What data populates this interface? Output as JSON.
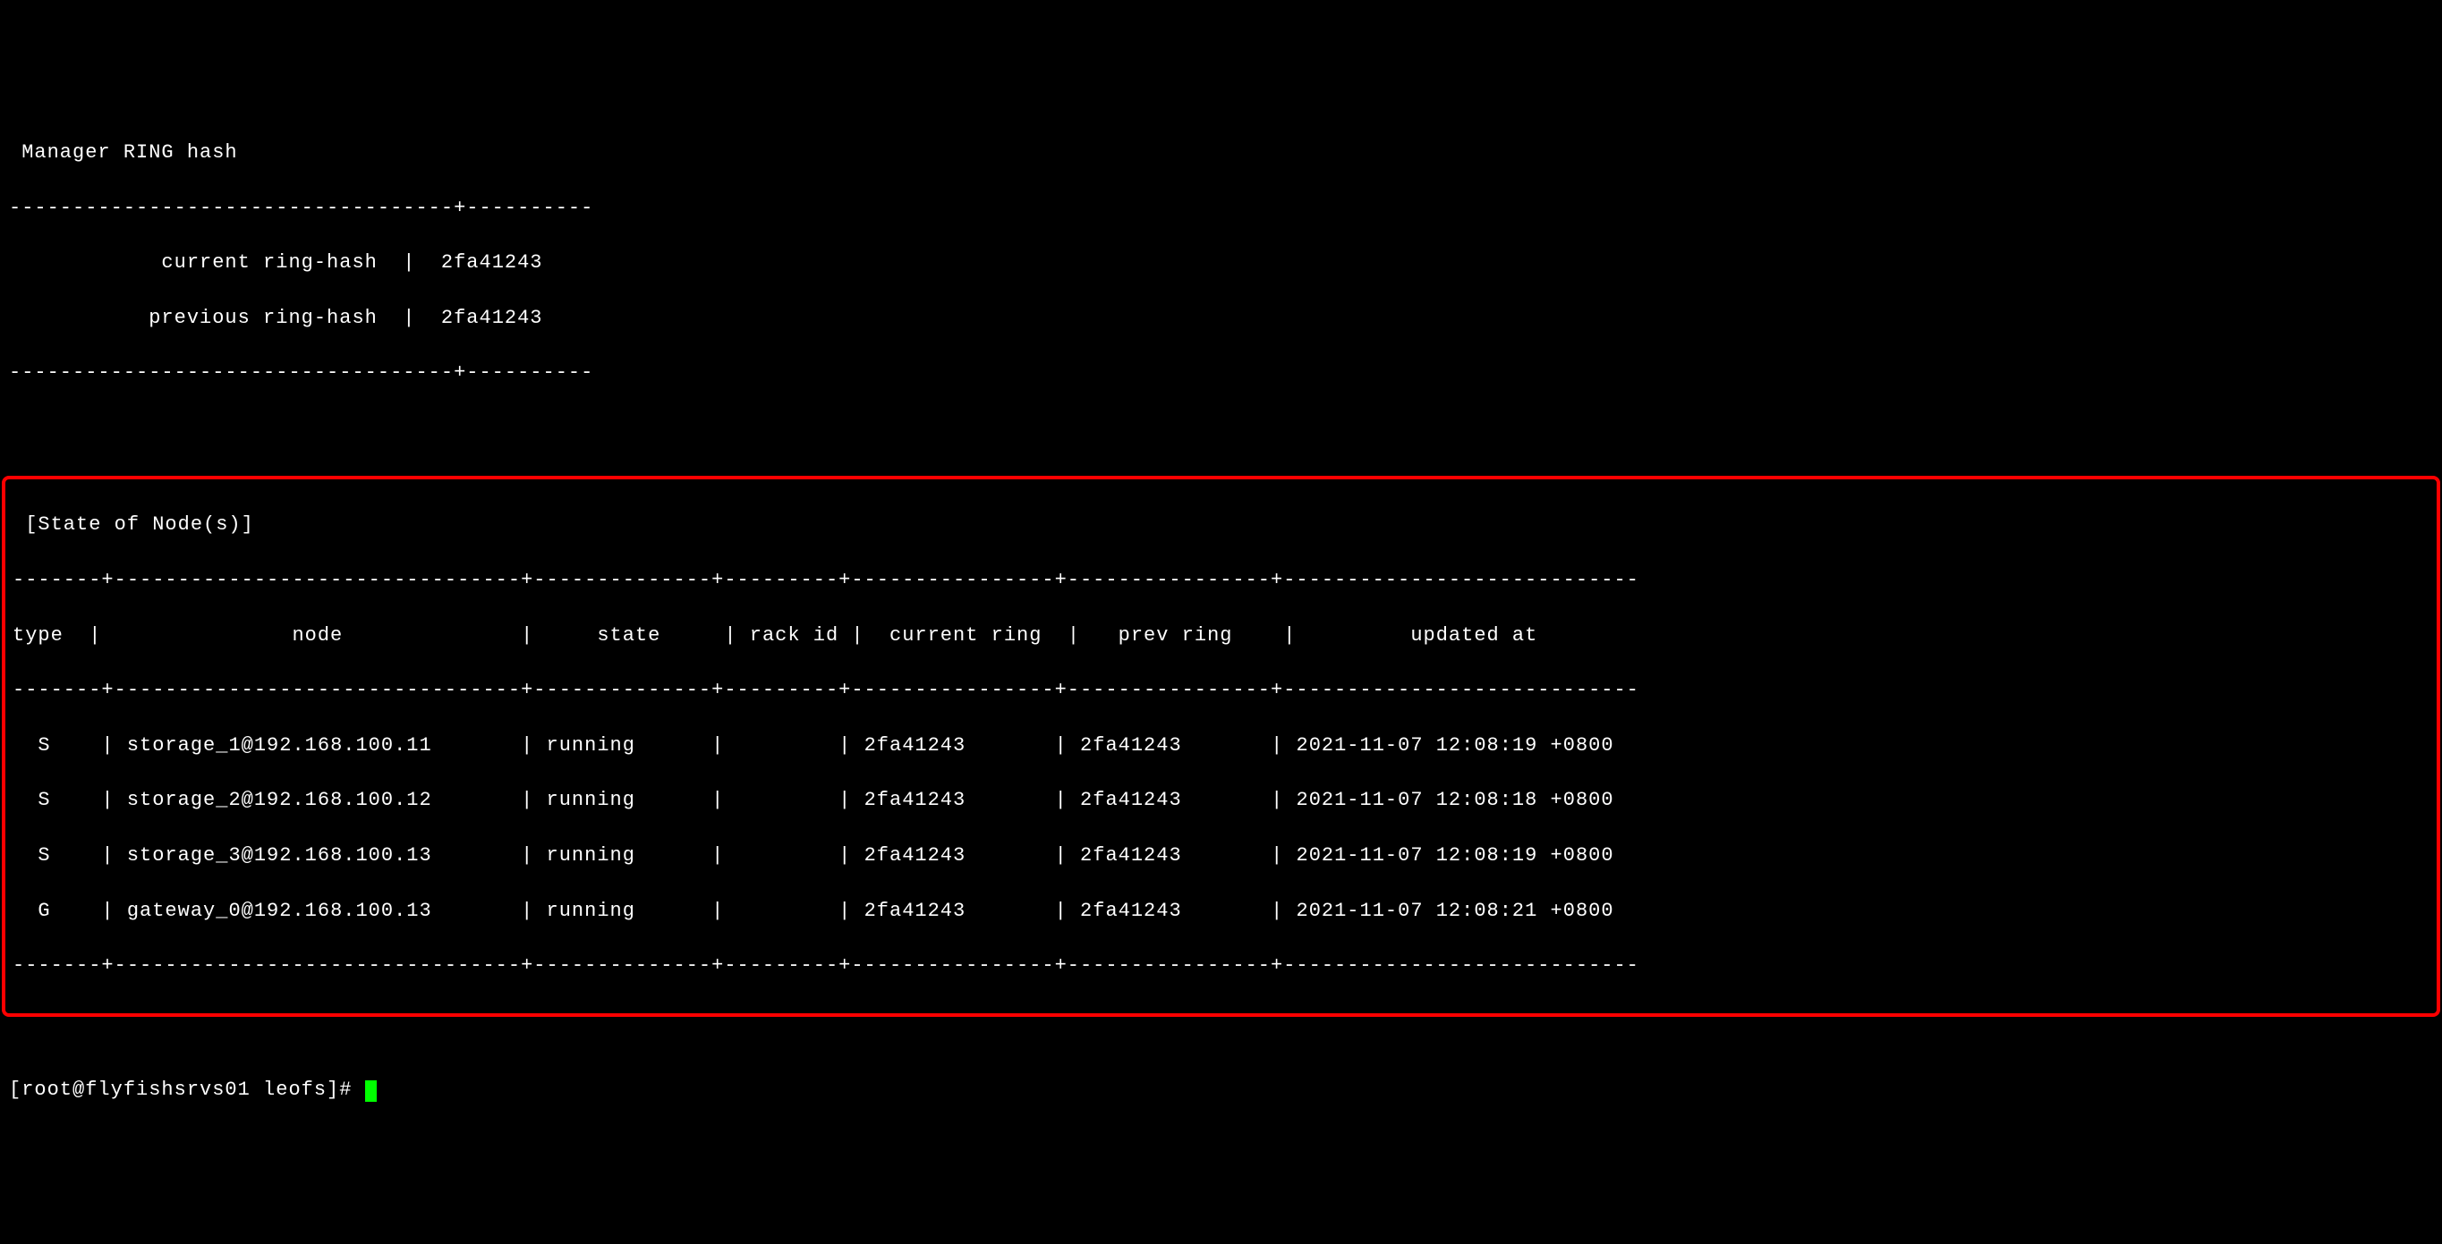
{
  "header": {
    "title": " Manager RING hash"
  },
  "ring_hash": {
    "separator_top": "-----------------------------------+----------",
    "current_label": "            current ring-hash",
    "current_value": "2fa41243",
    "previous_label": "           previous ring-hash",
    "previous_value": "2fa41243",
    "separator_bottom": "-----------------------------------+----------"
  },
  "state_section": {
    "title": " [State of Node(s)]",
    "border_top": "-------+--------------------------------+--------------+---------+----------------+----------------+----------------------------",
    "headers": {
      "type": "type ",
      "node": "              node             ",
      "state": "    state    ",
      "rack_id": " rack id",
      "current_ring": "  current ring ",
      "prev_ring": "   prev ring   ",
      "updated_at": "         updated at        "
    },
    "border_mid": "-------+--------------------------------+--------------+---------+----------------+----------------+----------------------------",
    "rows": [
      {
        "type": "  S   ",
        "node": "storage_1@192.168.100.11      ",
        "state": " running     ",
        "rack_id": "        ",
        "current_ring": " 2fa41243      ",
        "prev_ring": " 2fa41243      ",
        "updated_at": " 2021-11-07 12:08:19 +0800"
      },
      {
        "type": "  S   ",
        "node": "storage_2@192.168.100.12      ",
        "state": " running     ",
        "rack_id": "        ",
        "current_ring": " 2fa41243      ",
        "prev_ring": " 2fa41243      ",
        "updated_at": " 2021-11-07 12:08:18 +0800"
      },
      {
        "type": "  S   ",
        "node": "storage_3@192.168.100.13      ",
        "state": " running     ",
        "rack_id": "        ",
        "current_ring": " 2fa41243      ",
        "prev_ring": " 2fa41243      ",
        "updated_at": " 2021-11-07 12:08:19 +0800"
      },
      {
        "type": "  G   ",
        "node": "gateway_0@192.168.100.13      ",
        "state": " running     ",
        "rack_id": "        ",
        "current_ring": " 2fa41243      ",
        "prev_ring": " 2fa41243      ",
        "updated_at": " 2021-11-07 12:08:21 +0800"
      }
    ],
    "border_bottom": "-------+--------------------------------+--------------+---------+----------------+----------------+----------------------------"
  },
  "prompt": {
    "text": "[root@flyfishsrvs01 leofs]# "
  }
}
